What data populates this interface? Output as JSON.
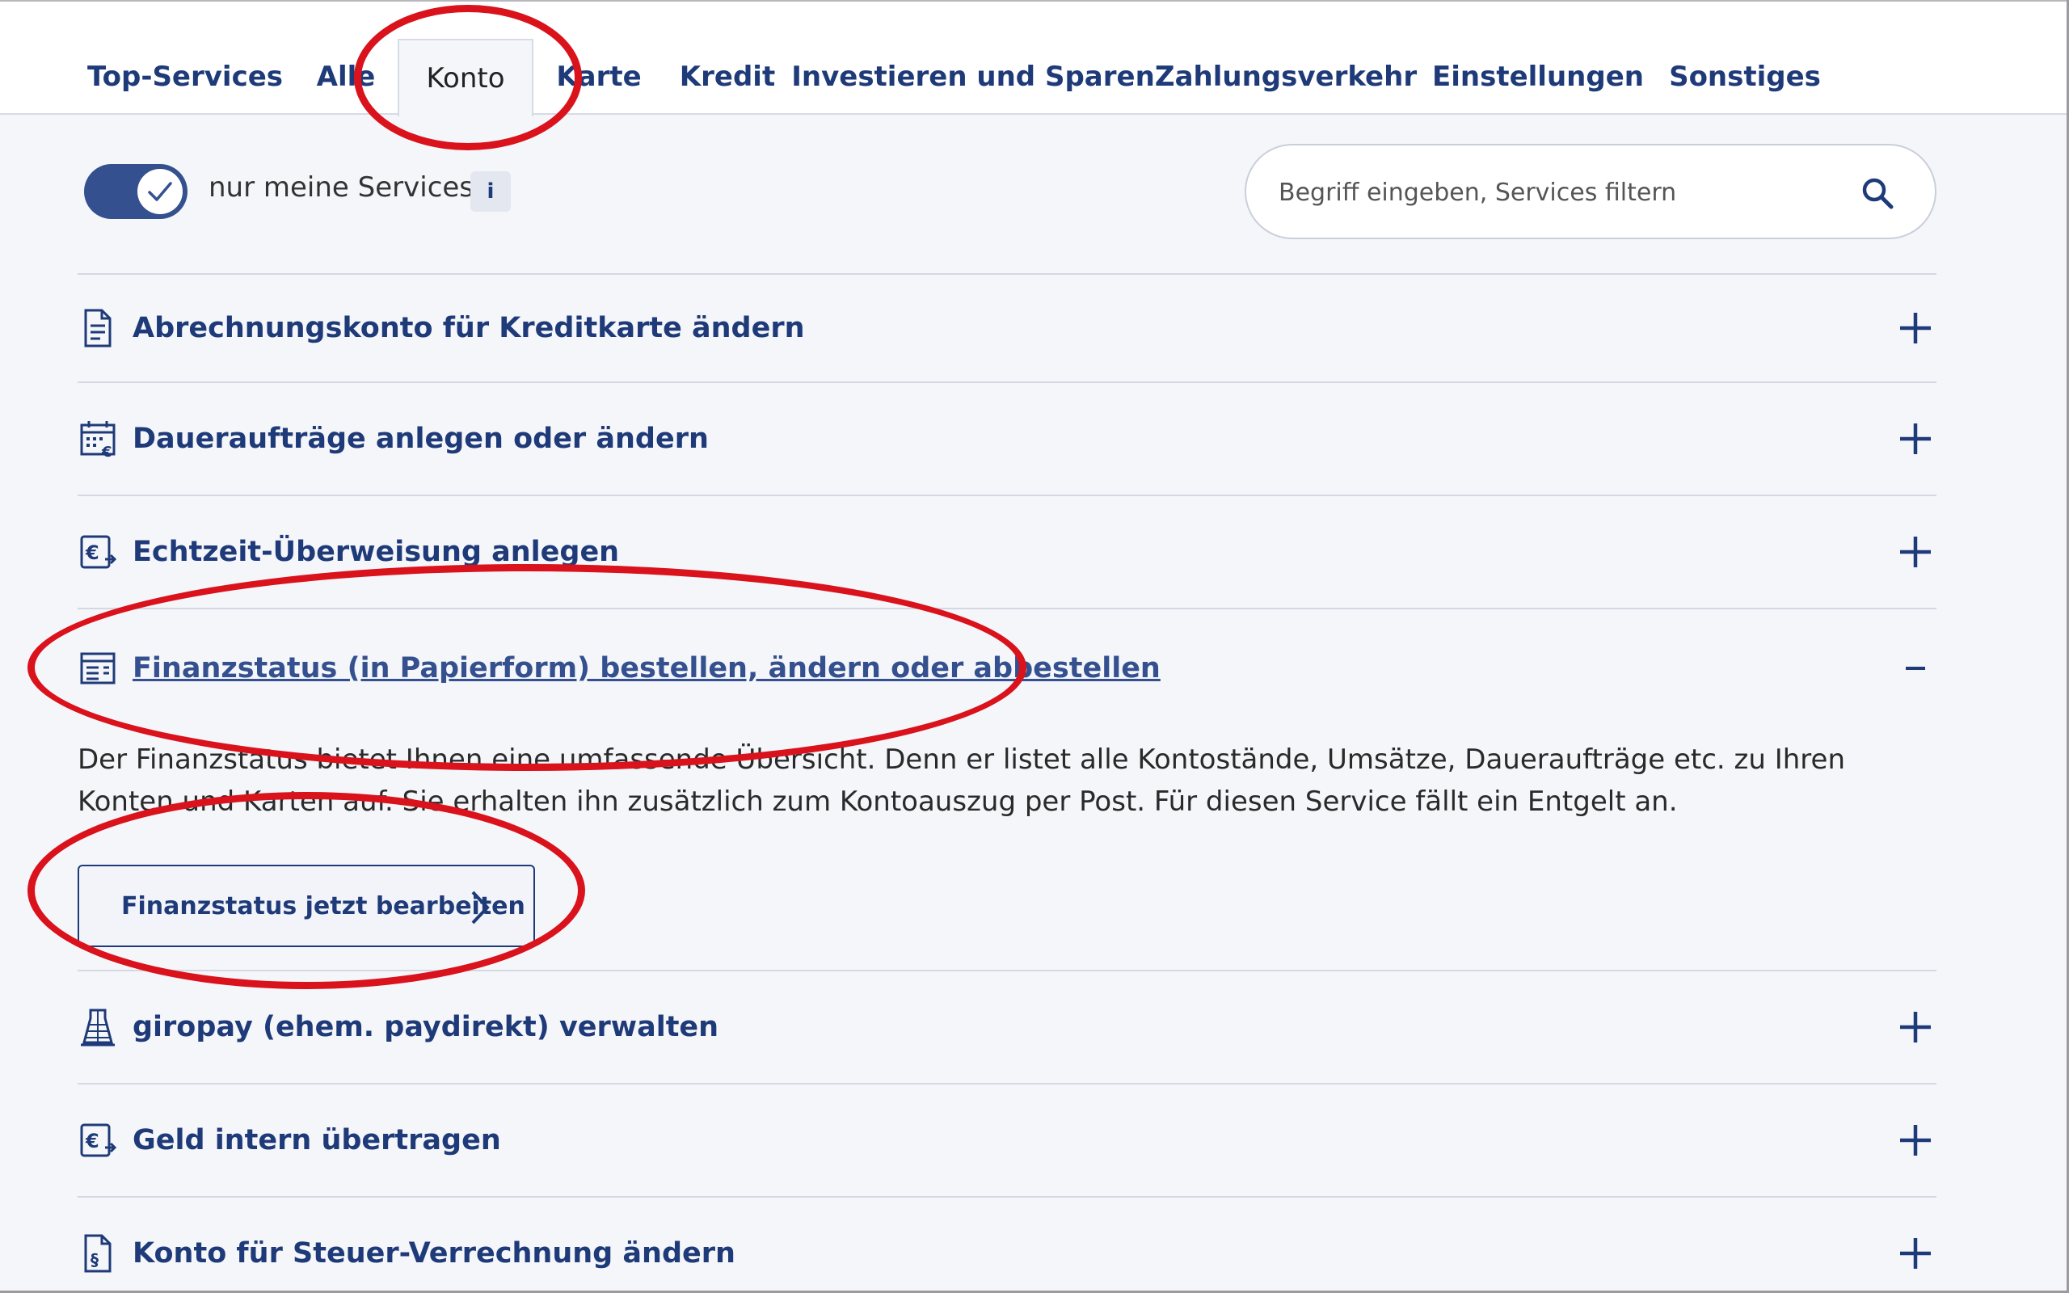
{
  "tabs": [
    {
      "label": "Top-Services"
    },
    {
      "label": "Alle"
    },
    {
      "label": "Konto"
    },
    {
      "label": "Karte"
    },
    {
      "label": "Kredit"
    },
    {
      "label": "Investieren und Sparen"
    },
    {
      "label": "Zahlungsverkehr"
    },
    {
      "label": "Einstellungen"
    },
    {
      "label": "Sonstiges"
    }
  ],
  "active_tab": "Konto",
  "filter": {
    "toggle_label": "nur meine Services",
    "toggle_on": true,
    "info_label": "i"
  },
  "search": {
    "placeholder": "Begriff eingeben, Services filtern"
  },
  "services": [
    {
      "title": "Abrechnungskonto für Kreditkarte ändern",
      "icon": "document-icon",
      "expanded": false
    },
    {
      "title": "Daueraufträge anlegen oder ändern",
      "icon": "calendar-euro-icon",
      "expanded": false
    },
    {
      "title": "Echtzeit-Überweisung anlegen",
      "icon": "euro-transfer-icon",
      "expanded": false
    },
    {
      "title": "Finanzstatus (in Papierform) bestellen, ändern oder abbestellen",
      "icon": "statement-icon",
      "expanded": true
    },
    {
      "title": "giropay (ehem. paydirekt) verwalten",
      "icon": "building-icon",
      "expanded": false
    },
    {
      "title": "Geld intern übertragen",
      "icon": "euro-transfer-icon",
      "expanded": false
    },
    {
      "title": "Konto für Steuer-Verrechnung ändern",
      "icon": "paragraph-document-icon",
      "expanded": false
    }
  ],
  "expanded_detail": {
    "description": "Der Finanzstatus bietet Ihnen eine umfassende Übersicht. Denn er listet alle Kontostände, Umsätze, Daueraufträge etc. zu Ihren Konten und Karten auf. Sie erhalten ihn zusätzlich zum Kontoauszug per Post. Für diesen Service fällt ein Entgelt an.",
    "button_label": "Finanzstatus jetzt bearbeiten"
  },
  "colors": {
    "brand_blue": "#1e3a78",
    "toggle_blue": "#34508f",
    "annotation_red": "#d9121c",
    "background": "#f5f6fa"
  }
}
